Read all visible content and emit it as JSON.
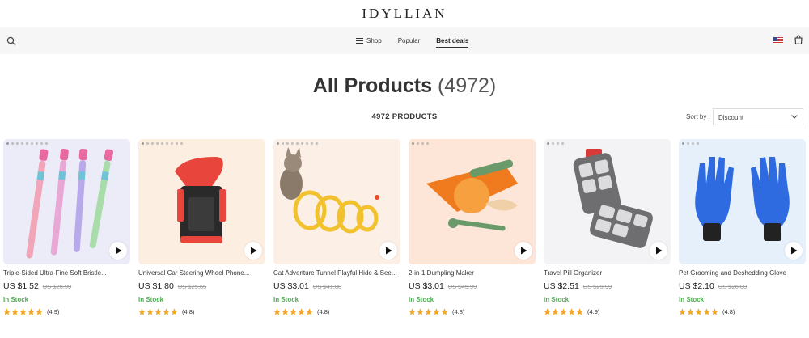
{
  "brand": {
    "name": "IDYLLIAN"
  },
  "nav": {
    "items": [
      {
        "label": "Shop",
        "icon": "menu-icon"
      },
      {
        "label": "Popular"
      },
      {
        "label": "Best deals",
        "active": true
      }
    ]
  },
  "page": {
    "title": "All Products",
    "title_count": "(4972)",
    "products_count": "4972 PRODUCTS"
  },
  "sort": {
    "label": "Sort by :",
    "selected": "Discount"
  },
  "products": [
    {
      "title": "Triple-Sided Ultra-Fine Soft Bristle...",
      "price": "US $1.52",
      "old_price": "US $26.99",
      "stock": "In Stock",
      "rating": "(4.9)",
      "stars": 5,
      "bg": "#ecebf8"
    },
    {
      "title": "Universal Car Steering Wheel Phone...",
      "price": "US $1.80",
      "old_price": "US $25.65",
      "stock": "In Stock",
      "rating": "(4.8)",
      "stars": 5,
      "bg": "#fdeee2"
    },
    {
      "title": "Cat Adventure Tunnel Playful Hide & See...",
      "price": "US $3.01",
      "old_price": "US $41.80",
      "stock": "In Stock",
      "rating": "(4.8)",
      "stars": 5,
      "bg": "#fcefe6"
    },
    {
      "title": "2-in-1 Dumpling Maker",
      "price": "US $3.01",
      "old_price": "US $45.99",
      "stock": "In Stock",
      "rating": "(4.8)",
      "stars": 5,
      "bg": "#fde6d8"
    },
    {
      "title": "Travel Pill Organizer",
      "price": "US $2.51",
      "old_price": "US $29.99",
      "stock": "In Stock",
      "rating": "(4.9)",
      "stars": 5,
      "bg": "#f3f3f6"
    },
    {
      "title": "Pet Grooming and Deshedding Glove",
      "price": "US $2.10",
      "old_price": "US $26.00",
      "stock": "In Stock",
      "rating": "(4.8)",
      "stars": 5,
      "bg": "#e6f0fb"
    }
  ],
  "colors": {
    "in_stock": "#4caf50",
    "star": "#f5a623",
    "navbar_bg": "#f6f6f6"
  }
}
